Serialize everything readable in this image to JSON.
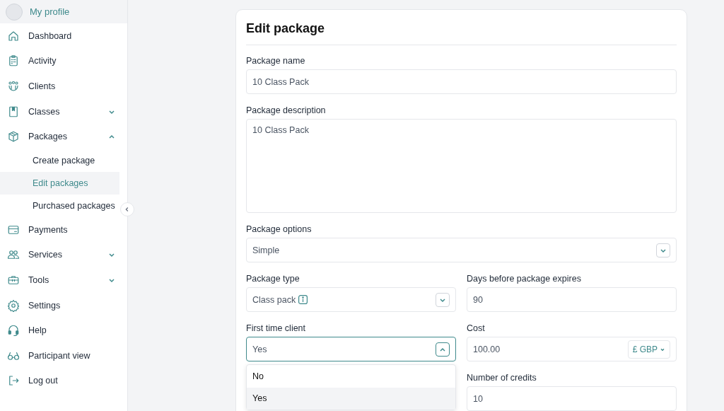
{
  "sidebar": {
    "profile": {
      "label": "My profile"
    },
    "items": [
      {
        "label": "Dashboard",
        "selected": false
      },
      {
        "label": "Activity",
        "selected": false
      },
      {
        "label": "Clients",
        "selected": false
      },
      {
        "label": "Classes",
        "selected": false,
        "expanded": false
      },
      {
        "label": "Packages",
        "selected": false,
        "expanded": true,
        "children": [
          {
            "label": "Create package",
            "selected": false
          },
          {
            "label": "Edit packages",
            "selected": true
          },
          {
            "label": "Purchased packages",
            "selected": false
          }
        ]
      },
      {
        "label": "Payments",
        "selected": false
      },
      {
        "label": "Services",
        "selected": false,
        "expanded": false
      },
      {
        "label": "Tools",
        "selected": false,
        "expanded": false
      },
      {
        "label": "Settings",
        "selected": false
      },
      {
        "label": "Help",
        "selected": false
      },
      {
        "label": "Participant view",
        "selected": false
      },
      {
        "label": "Log out",
        "selected": false
      }
    ]
  },
  "form": {
    "title": "Edit package",
    "fields": [
      {
        "kind": "text",
        "label": "Package name",
        "value": "10 Class Pack"
      },
      {
        "kind": "textarea",
        "label": "Package description",
        "value": "10 Class Pack"
      },
      {
        "kind": "select",
        "label": "Package options",
        "value": "Simple",
        "expanded": false
      }
    ],
    "columns": [
      [
        {
          "kind": "select",
          "label": "Package type",
          "value": "Class pack",
          "info": true,
          "expanded": false
        },
        {
          "kind": "select",
          "label": "First time client",
          "value": "Yes",
          "expanded": true,
          "options": [
            {
              "label": "No",
              "selected": false
            },
            {
              "label": "Yes",
              "selected": true
            }
          ]
        }
      ],
      [
        {
          "kind": "text",
          "label": "Days before package expires",
          "value": "90"
        },
        {
          "kind": "money",
          "label": "Cost",
          "value": "100.00",
          "currency": "£ GBP"
        },
        {
          "kind": "text",
          "label": "Number of credits",
          "value": "10"
        }
      ]
    ]
  }
}
